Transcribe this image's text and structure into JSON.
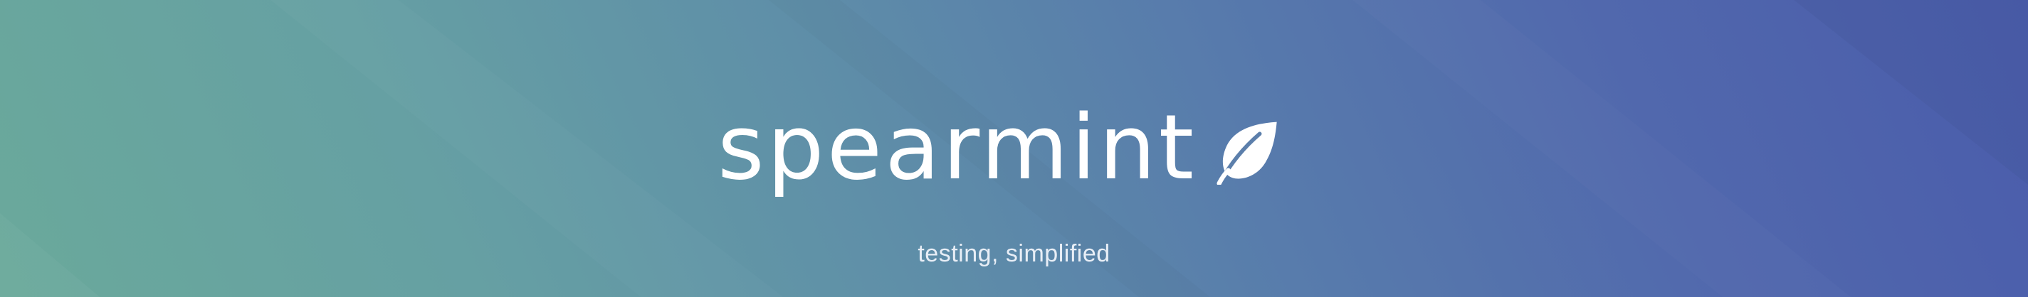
{
  "brand": {
    "name": "spearmint",
    "tagline": "testing, simplified",
    "logo_icon": "leaf-icon"
  },
  "colors": {
    "gradient_start": "#6aa99b",
    "gradient_mid": "#5f8fa8",
    "gradient_end": "#4a5cab",
    "text": "#ffffff",
    "tagline_text": "#e8eef6"
  }
}
